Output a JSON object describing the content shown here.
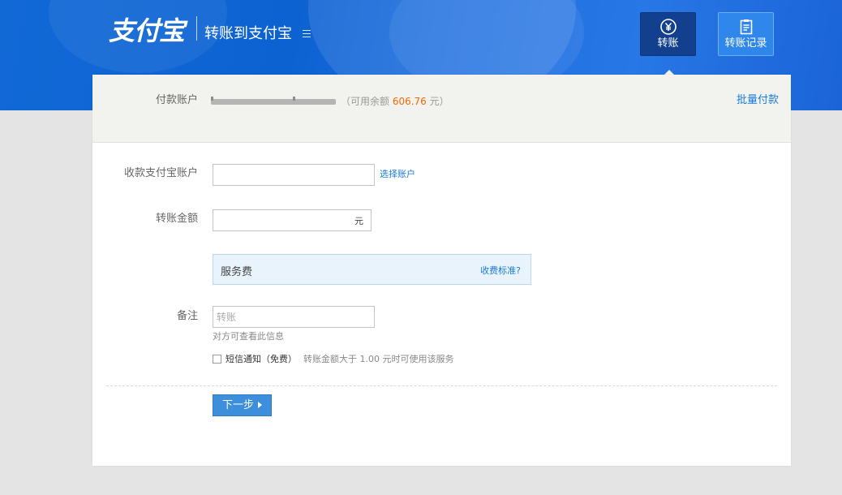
{
  "header": {
    "logo_text": "支付宝",
    "app_title": "转账到支付宝",
    "nav": [
      {
        "label": "转账",
        "icon": "yuan-circle-icon",
        "active": true
      },
      {
        "label": "转账记录",
        "icon": "clipboard-icon",
        "active": false
      }
    ]
  },
  "payer": {
    "label": "付款账户",
    "balance_prefix": "（可用余额 ",
    "balance_amount": "606.76",
    "balance_suffix": " 元）",
    "batch_pay": "批量付款"
  },
  "form": {
    "recipient": {
      "label": "收款支付宝账户",
      "value": "",
      "choose_link": "选择账户"
    },
    "amount": {
      "label": "转账金额",
      "value": "",
      "unit": "元"
    },
    "fee": {
      "label": "服务费",
      "standard_link": "收费标准?"
    },
    "memo": {
      "label": "备注",
      "placeholder": "转账",
      "hint": "对方可查看此信息"
    },
    "sms": {
      "label": "短信通知（免费）",
      "note": "转账金额大于 1.00 元时可使用该服务",
      "checked": false
    },
    "next_button": "下一步"
  },
  "colors": {
    "banner_blue": "#1169d6",
    "active_nav": "#123f8e",
    "balance_orange": "#f06a00",
    "link_blue": "#1a7bd6",
    "button_blue": "#3d8fdc"
  }
}
